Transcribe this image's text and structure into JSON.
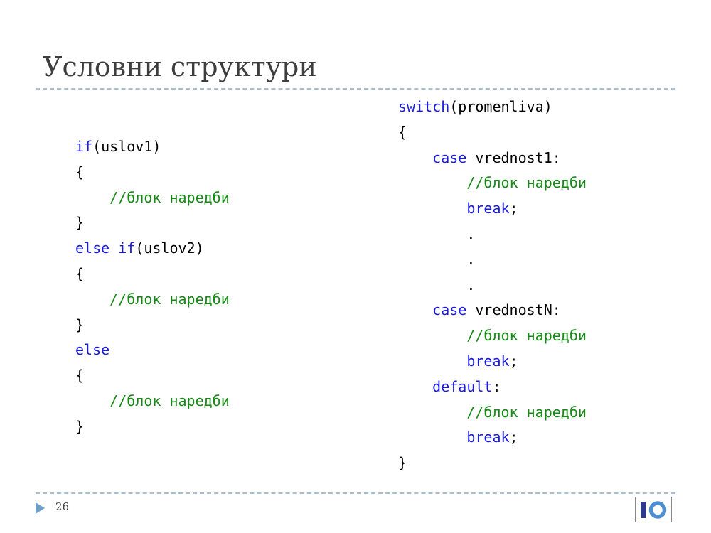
{
  "slide": {
    "title": "Условни структури",
    "page_number": "26"
  },
  "code_left": [
    [
      {
        "t": "if",
        "c": "kw"
      },
      {
        "t": "(uslov1)",
        "c": "tx"
      }
    ],
    [
      {
        "t": "{",
        "c": "tx"
      }
    ],
    [
      {
        "t": "    ",
        "c": "tx"
      },
      {
        "t": "//блок наредби",
        "c": "cm"
      }
    ],
    [
      {
        "t": "}",
        "c": "tx"
      }
    ],
    [
      {
        "t": "else",
        "c": "kw"
      },
      {
        "t": " ",
        "c": "tx"
      },
      {
        "t": "if",
        "c": "kw"
      },
      {
        "t": "(uslov2)",
        "c": "tx"
      }
    ],
    [
      {
        "t": "{",
        "c": "tx"
      }
    ],
    [
      {
        "t": "    ",
        "c": "tx"
      },
      {
        "t": "//блок наредби",
        "c": "cm"
      }
    ],
    [
      {
        "t": "}",
        "c": "tx"
      }
    ],
    [
      {
        "t": "else",
        "c": "kw"
      }
    ],
    [
      {
        "t": "{",
        "c": "tx"
      }
    ],
    [
      {
        "t": "    ",
        "c": "tx"
      },
      {
        "t": "//блок наредби",
        "c": "cm"
      }
    ],
    [
      {
        "t": "}",
        "c": "tx"
      }
    ]
  ],
  "code_right": [
    [
      {
        "t": "switch",
        "c": "kw"
      },
      {
        "t": "(promenliva)",
        "c": "tx"
      }
    ],
    [
      {
        "t": "{",
        "c": "tx"
      }
    ],
    [
      {
        "t": "    ",
        "c": "tx"
      },
      {
        "t": "case",
        "c": "kw"
      },
      {
        "t": " vrednost1:",
        "c": "tx"
      }
    ],
    [
      {
        "t": "        ",
        "c": "tx"
      },
      {
        "t": "//блок наредби",
        "c": "cm"
      }
    ],
    [
      {
        "t": "        ",
        "c": "tx"
      },
      {
        "t": "break",
        "c": "kw"
      },
      {
        "t": ";",
        "c": "tx"
      }
    ],
    [
      {
        "t": "        .",
        "c": "tx"
      }
    ],
    [
      {
        "t": "        .",
        "c": "tx"
      }
    ],
    [
      {
        "t": "        .",
        "c": "tx"
      }
    ],
    [
      {
        "t": "    ",
        "c": "tx"
      },
      {
        "t": "case",
        "c": "kw"
      },
      {
        "t": " vrednostN:",
        "c": "tx"
      }
    ],
    [
      {
        "t": "        ",
        "c": "tx"
      },
      {
        "t": "//блок наредби",
        "c": "cm"
      }
    ],
    [
      {
        "t": "        ",
        "c": "tx"
      },
      {
        "t": "break",
        "c": "kw"
      },
      {
        "t": ";",
        "c": "tx"
      }
    ],
    [
      {
        "t": "    ",
        "c": "tx"
      },
      {
        "t": "default",
        "c": "kw"
      },
      {
        "t": ":",
        "c": "tx"
      }
    ],
    [
      {
        "t": "        ",
        "c": "tx"
      },
      {
        "t": "//блок наредби",
        "c": "cm"
      }
    ],
    [
      {
        "t": "        ",
        "c": "tx"
      },
      {
        "t": "break",
        "c": "kw"
      },
      {
        "t": ";",
        "c": "tx"
      }
    ],
    [
      {
        "t": "}",
        "c": "tx"
      }
    ]
  ],
  "colors": {
    "keyword": "#1a1ae0",
    "comment": "#158a15",
    "text": "#000000",
    "title": "#3e3e3e",
    "rule": "#a9bdd0",
    "accent_arrow": "#6f9fc8",
    "logo_navy": "#2b3a8c",
    "logo_blue": "#4f8fd0"
  },
  "icons": {
    "footer_bullet": "triangle-right-icon",
    "logo": "io-logo-icon"
  }
}
